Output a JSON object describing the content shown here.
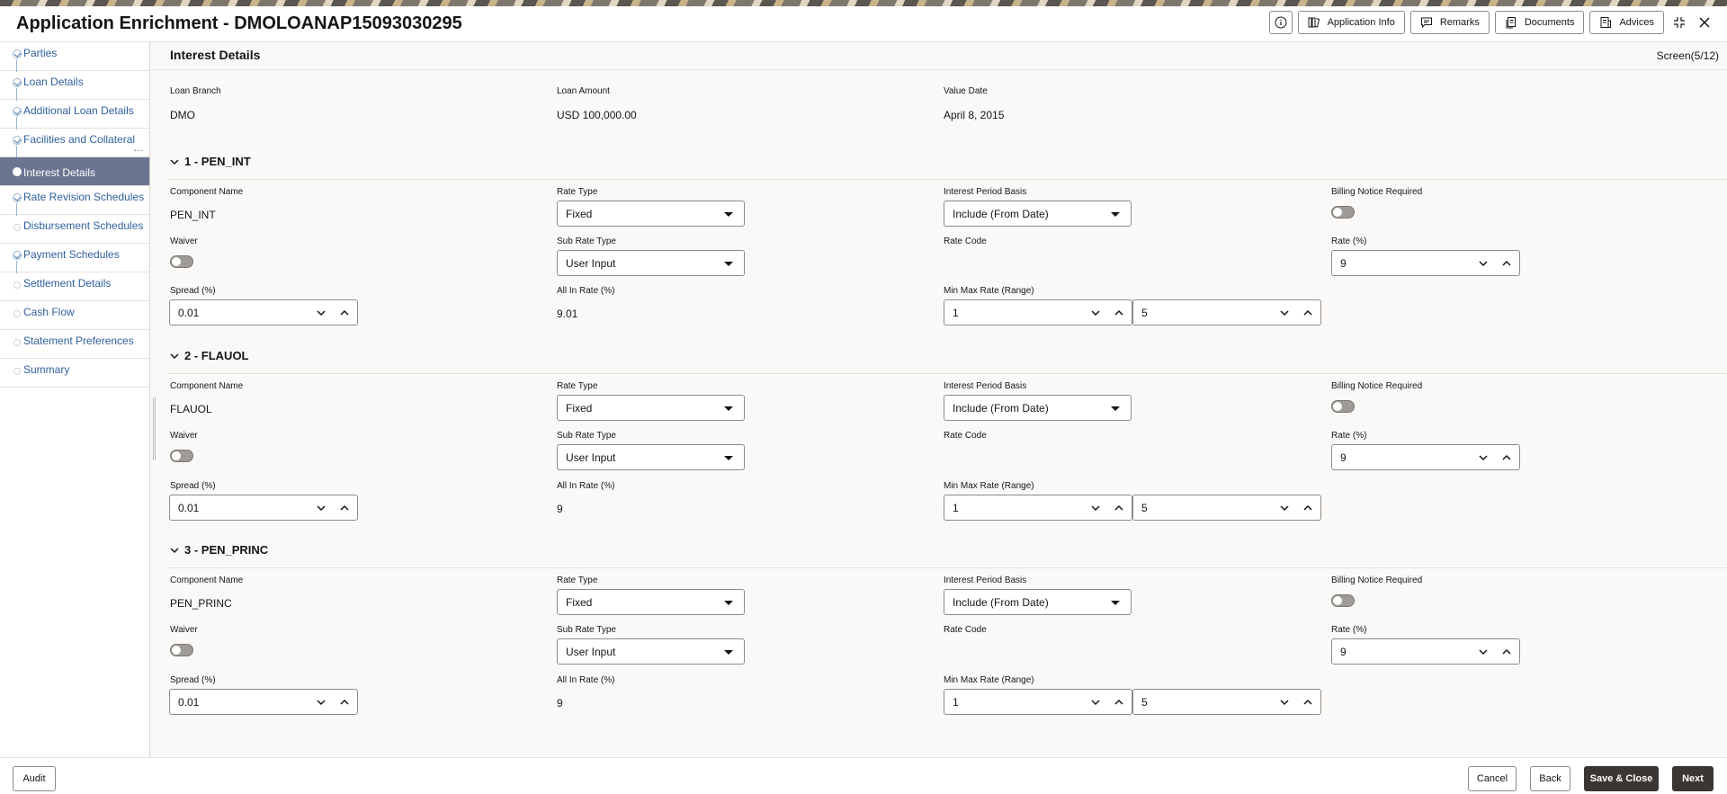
{
  "app": {
    "title": "Application Enrichment - DMOLOANAP15093030295"
  },
  "toolbar": {
    "application_info": "Application Info",
    "remarks": "Remarks",
    "documents": "Documents",
    "advices": "Advices"
  },
  "sidebar": {
    "items": [
      {
        "label": "Parties",
        "state": "done"
      },
      {
        "label": "Loan Details",
        "state": "done"
      },
      {
        "label": "Additional Loan Details",
        "state": "done"
      },
      {
        "label": "Facilities and Collateral",
        "state": "done"
      },
      {
        "label": "Interest Details",
        "state": "active"
      },
      {
        "label": "Rate Revision Schedules",
        "state": "done"
      },
      {
        "label": "Disbursement Schedules",
        "state": "pending"
      },
      {
        "label": "Payment Schedules",
        "state": "done"
      },
      {
        "label": "Settlement Details",
        "state": "pending"
      },
      {
        "label": "Cash Flow",
        "state": "pending"
      },
      {
        "label": "Statement Preferences",
        "state": "pending"
      },
      {
        "label": "Summary",
        "state": "pending"
      }
    ]
  },
  "page": {
    "title": "Interest Details",
    "screen": "Screen(5/12)"
  },
  "summary": {
    "loan_branch_label": "Loan Branch",
    "loan_branch": "DMO",
    "loan_amount_label": "Loan Amount",
    "loan_amount": "USD 100,000.00",
    "value_date_label": "Value Date",
    "value_date": "April 8, 2015"
  },
  "labels": {
    "component_name": "Component Name",
    "rate_type": "Rate Type",
    "interest_period_basis": "Interest Period Basis",
    "billing_notice_required": "Billing Notice Required",
    "waiver": "Waiver",
    "sub_rate_type": "Sub Rate Type",
    "rate_code": "Rate Code",
    "rate": "Rate (%)",
    "spread": "Spread (%)",
    "all_in_rate": "All In Rate (%)",
    "min_max_rate": "Min Max Rate (Range)"
  },
  "components": [
    {
      "heading": "1 - PEN_INT",
      "name": "PEN_INT",
      "rate_type": "Fixed",
      "interest_period_basis": "Include (From Date)",
      "billing_notice": false,
      "waiver": false,
      "sub_rate_type": "User Input",
      "rate": "9",
      "spread": "0.01",
      "all_in_rate": "9.01",
      "min_rate": "1",
      "max_rate": "5"
    },
    {
      "heading": "2 - FLAUOL",
      "name": "FLAUOL",
      "rate_type": "Fixed",
      "interest_period_basis": "Include (From Date)",
      "billing_notice": false,
      "waiver": false,
      "sub_rate_type": "User Input",
      "rate": "9",
      "spread": "0.01",
      "all_in_rate": "9",
      "min_rate": "1",
      "max_rate": "5"
    },
    {
      "heading": "3 - PEN_PRINC",
      "name": "PEN_PRINC",
      "rate_type": "Fixed",
      "interest_period_basis": "Include (From Date)",
      "billing_notice": false,
      "waiver": false,
      "sub_rate_type": "User Input",
      "rate": "9",
      "spread": "0.01",
      "all_in_rate": "9",
      "min_rate": "1",
      "max_rate": "5"
    }
  ],
  "footer": {
    "audit": "Audit",
    "cancel": "Cancel",
    "back": "Back",
    "save_close": "Save & Close",
    "next": "Next"
  }
}
